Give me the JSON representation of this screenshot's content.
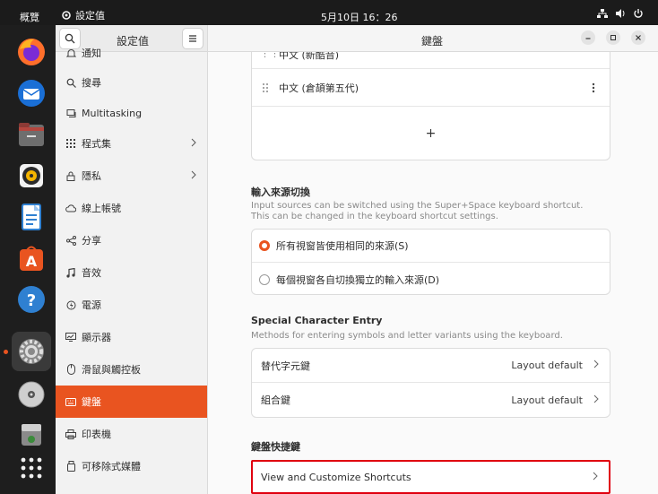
{
  "topbar": {
    "activities": "概覽",
    "app_name": "設定值",
    "clock": "5月10日  16：26"
  },
  "dock": {
    "apps": [
      "firefox-icon",
      "thunderbird-icon",
      "files-icon",
      "rhythmbox-icon",
      "writer-icon",
      "app-center-icon",
      "help-icon",
      "settings-icon",
      "disc-icon",
      "trash-icon",
      "app-grid-icon"
    ]
  },
  "sidebar": {
    "title": "設定值",
    "items": [
      {
        "label": "通知",
        "icon": "bell-icon"
      },
      {
        "label": "搜尋",
        "icon": "search-icon"
      },
      {
        "label": "Multitasking",
        "icon": "multitasking-icon"
      },
      {
        "label": "程式集",
        "icon": "apps-grid-icon"
      },
      {
        "label": "隱私",
        "icon": "lock-icon"
      },
      {
        "label": "線上帳號",
        "icon": "cloud-icon"
      },
      {
        "label": "分享",
        "icon": "share-icon"
      },
      {
        "label": "音效",
        "icon": "music-note-icon"
      },
      {
        "label": "電源",
        "icon": "power-icon"
      },
      {
        "label": "顯示器",
        "icon": "display-icon"
      },
      {
        "label": "滑鼠與觸控板",
        "icon": "mouse-icon"
      },
      {
        "label": "鍵盤",
        "icon": "keyboard-icon"
      },
      {
        "label": "印表機",
        "icon": "printer-icon"
      },
      {
        "label": "可移除式媒體",
        "icon": "removable-media-icon"
      }
    ]
  },
  "content": {
    "title": "鍵盤",
    "input_sources": {
      "partial_row": "中文 (新酷音)",
      "row": "中文 (倉頡第五代)",
      "add": "+"
    },
    "switching": {
      "title": "輸入來源切換",
      "desc1": "Input sources can be switched using the Super+Space keyboard shortcut.",
      "desc2": "This can be changed in the keyboard shortcut settings.",
      "opt1": "所有視窗皆使用相同的來源(S)",
      "opt2": "每個視窗各自切換獨立的輸入來源(D)"
    },
    "special": {
      "title": "Special Character Entry",
      "desc": "Methods for entering symbols and letter variants using the keyboard.",
      "alt_label": "替代字元鍵",
      "alt_value": "Layout default",
      "compose_label": "組合鍵",
      "compose_value": "Layout default"
    },
    "shortcuts": {
      "title": "鍵盤快捷鍵",
      "row": "View and Customize Shortcuts"
    }
  },
  "colors": {
    "accent": "#e95420",
    "highlight": "#e0000f"
  }
}
